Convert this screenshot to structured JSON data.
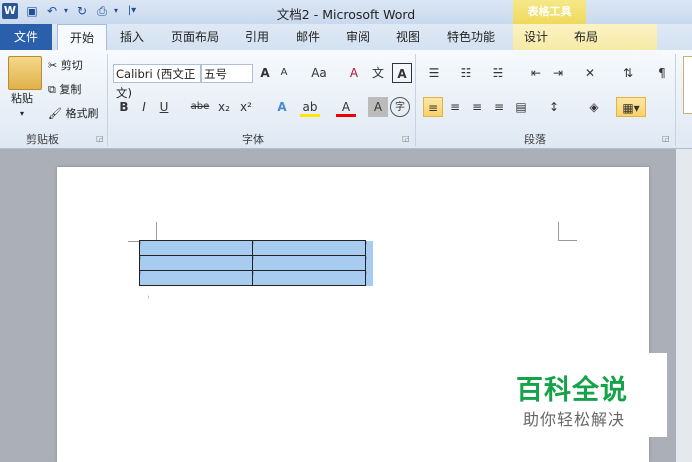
{
  "window": {
    "title": "文档2 - Microsoft Word",
    "app_icon": "W"
  },
  "quick_access": [
    "save-icon",
    "undo-icon",
    "redo-icon",
    "print-preview-icon",
    "customize-icon"
  ],
  "contextual": {
    "label": "表格工具"
  },
  "tabs": [
    "文件",
    "开始",
    "插入",
    "页面布局",
    "引用",
    "邮件",
    "审阅",
    "视图",
    "特色功能",
    "设计",
    "布局"
  ],
  "clipboard": {
    "paste": "粘贴",
    "cut": "剪切",
    "copy": "复制",
    "format_painter": "格式刷",
    "label": "剪贴板"
  },
  "font": {
    "name": "Calibri (西文正文)",
    "size": "五号",
    "label": "字体",
    "bold": "B",
    "italic": "I",
    "underline": "U",
    "strike": "abe",
    "sub": "x₂",
    "sup": "x²",
    "grow": "A",
    "shrink": "A",
    "case": "Aa",
    "clear": "A",
    "phonetic": "文",
    "border_char": "A",
    "text_effect": "A",
    "highlight": "ab",
    "font_color": "A",
    "char_shade": "A",
    "enclose": "字"
  },
  "paragraph": {
    "label": "段落"
  },
  "table": {
    "rows": 3,
    "cols": 2,
    "cell_mark": "ˡ"
  },
  "watermark": {
    "main": "百科全说",
    "sub": "助你轻松解决"
  },
  "colors": {
    "file_tab": "#2a5fac",
    "table_tools": "#efd95c",
    "selection": "#a8ccef",
    "watermark": "#15a34a"
  }
}
